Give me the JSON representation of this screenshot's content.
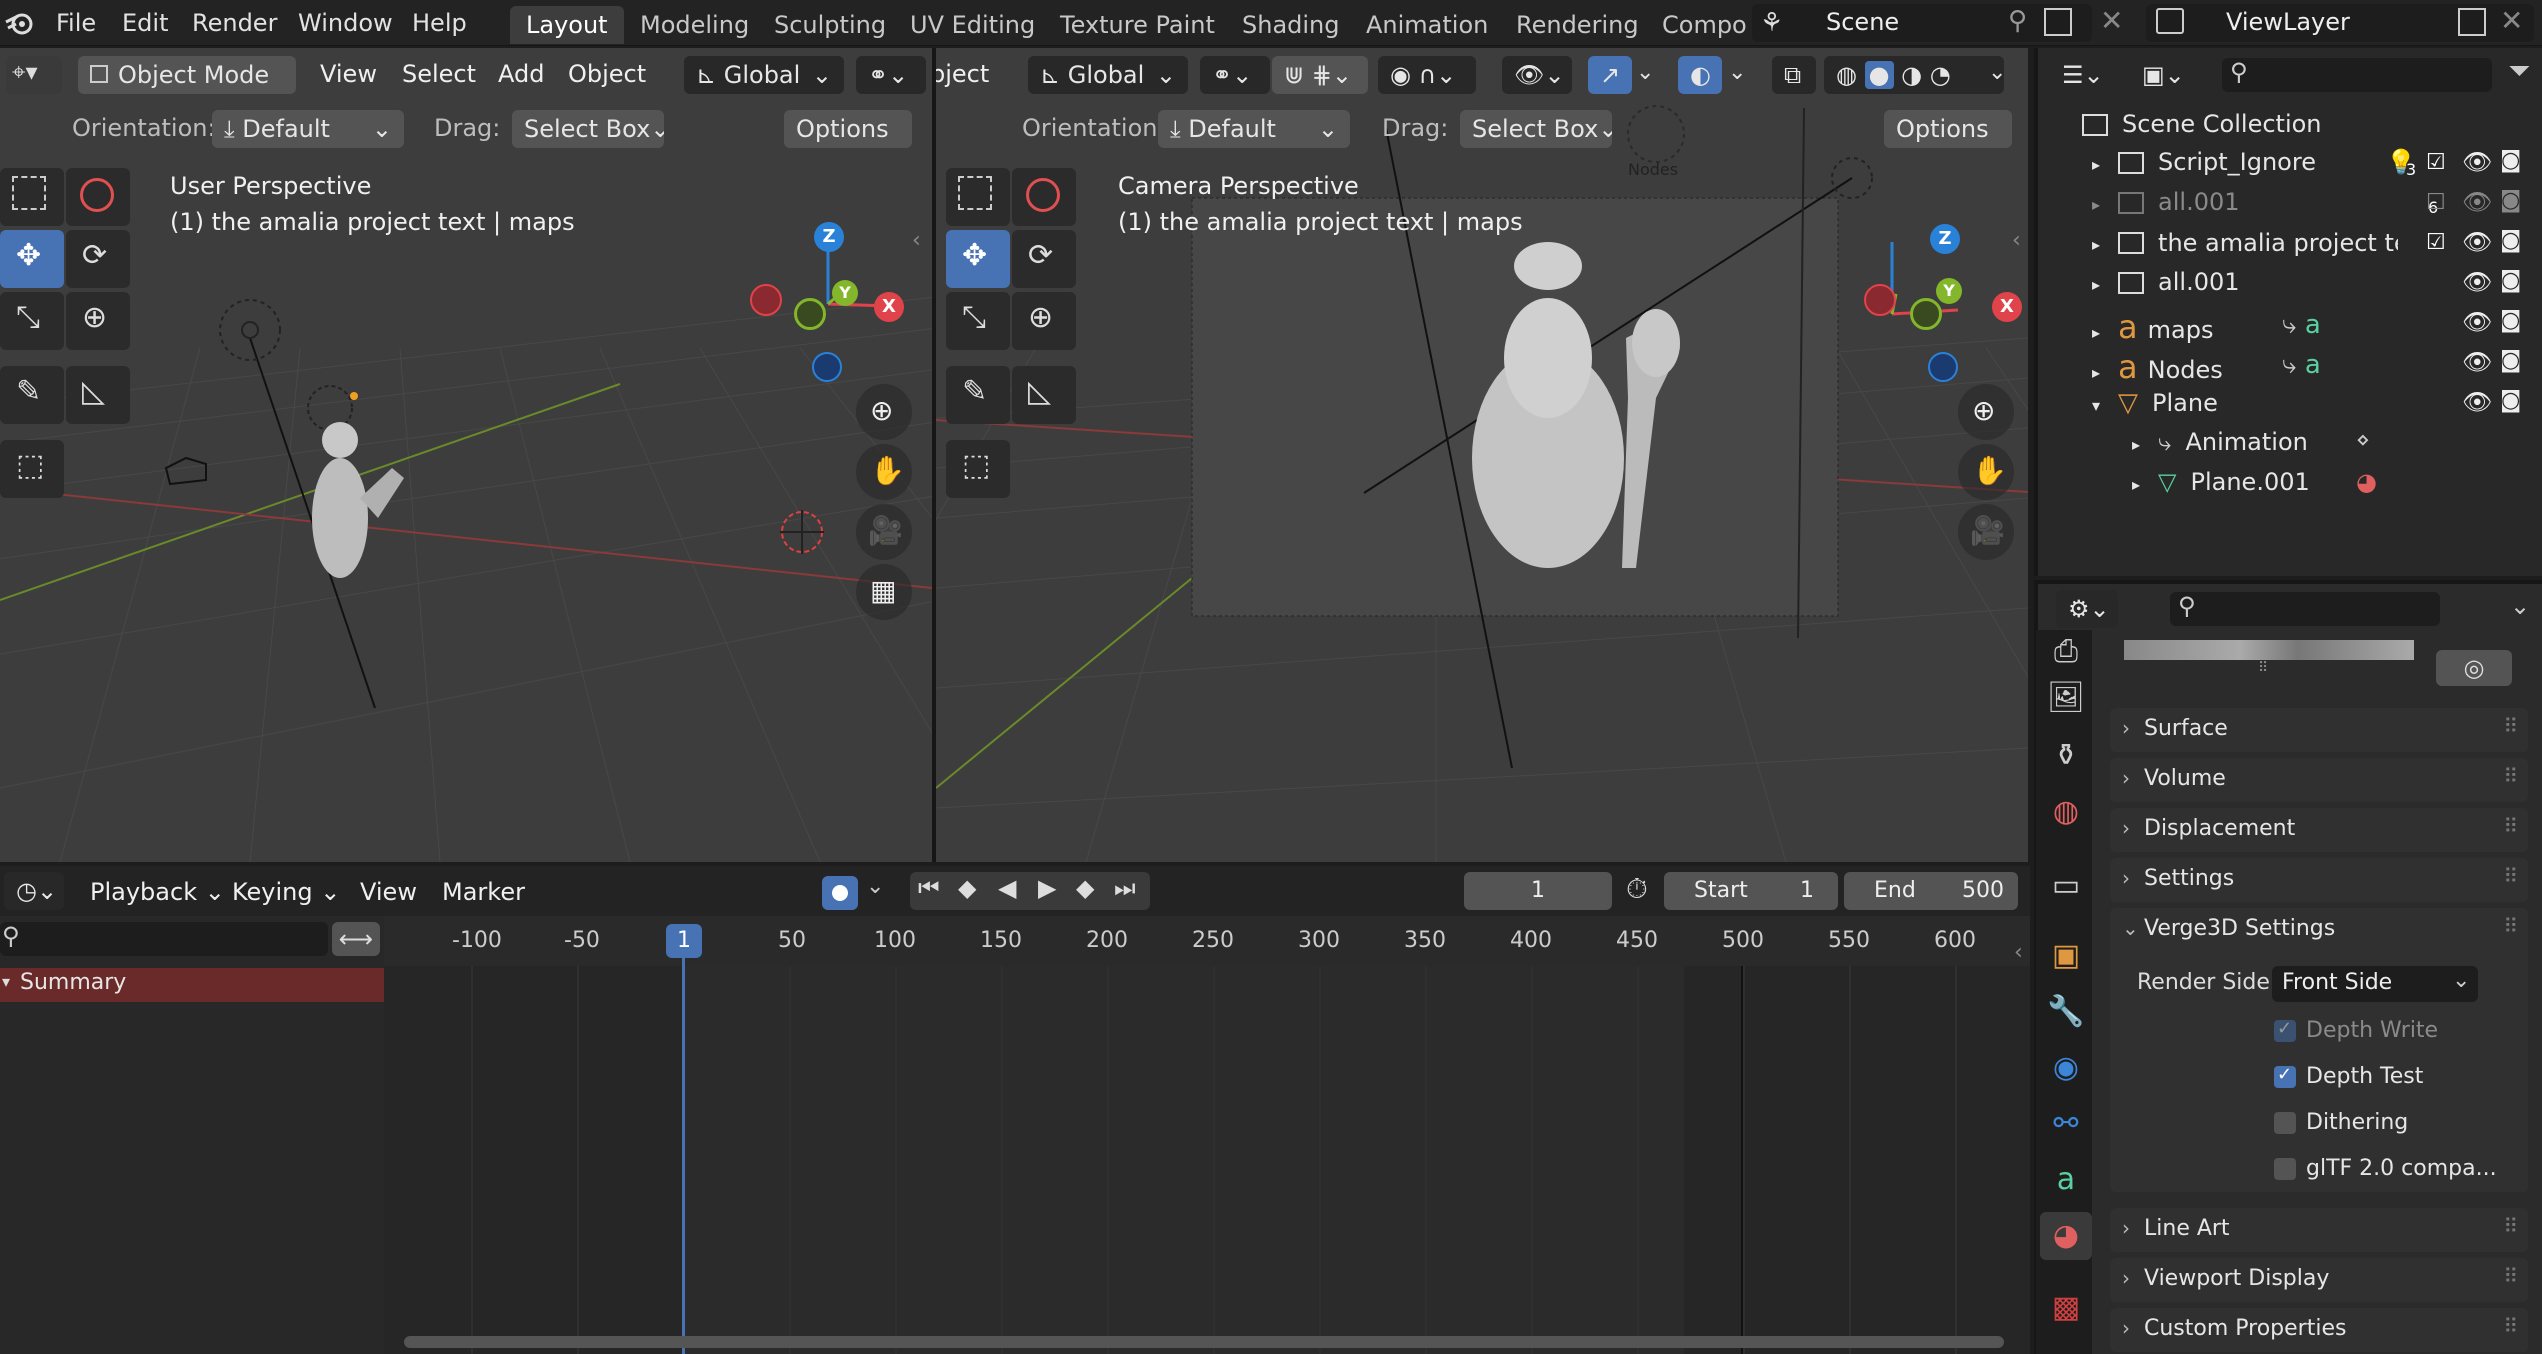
{
  "menu": {
    "file": "File",
    "edit": "Edit",
    "render": "Render",
    "window": "Window",
    "help": "Help"
  },
  "workspaces": [
    "Layout",
    "Modeling",
    "Sculpting",
    "UV Editing",
    "Texture Paint",
    "Shading",
    "Animation",
    "Rendering",
    "Compo"
  ],
  "scene": "Scene",
  "view_layer": "ViewLayer",
  "left_view": {
    "mode": "Object Mode",
    "view": "View",
    "select": "Select",
    "add": "Add",
    "object": "Object",
    "transform": "Global",
    "orientation_label": "Orientation:",
    "orientation": "Default",
    "drag_label": "Drag:",
    "drag": "Select Box",
    "options": "Options",
    "title": "User Perspective",
    "subtitle": "(1) the amalia project text | maps"
  },
  "right_view": {
    "partial": "bject",
    "transform": "Global",
    "orientation_label": "Orientation:",
    "orientation": "Default",
    "drag_label": "Drag:",
    "drag": "Select Box",
    "options": "Options",
    "title": "Camera Perspective",
    "subtitle": "(1) the amalia project text | maps",
    "nodes_label": "Nodes"
  },
  "gizmo": {
    "x": "X",
    "y": "Y",
    "z": "Z"
  },
  "outliner": {
    "root": "Scene Collection",
    "items": [
      {
        "label": "Script_Ignore",
        "badge": "3"
      },
      {
        "label": "all.001",
        "badge": "6"
      },
      {
        "label": "the amalia project text"
      },
      {
        "label": "all.001"
      },
      {
        "label": "maps"
      },
      {
        "label": "Nodes"
      },
      {
        "label": "Plane"
      },
      {
        "label": "Animation"
      },
      {
        "label": "Plane.001"
      }
    ]
  },
  "properties": {
    "sections": [
      "Surface",
      "Volume",
      "Displacement",
      "Settings"
    ],
    "verge": {
      "title": "Verge3D Settings",
      "render_side_label": "Render Side",
      "render_side": "Front Side",
      "checks": [
        {
          "label": "Depth Write",
          "checked": true,
          "disabled": true
        },
        {
          "label": "Depth Test",
          "checked": true
        },
        {
          "label": "Dithering",
          "checked": false
        },
        {
          "label": "glTF 2.0 compa...",
          "checked": false
        }
      ]
    },
    "sections2": [
      "Line Art",
      "Viewport Display",
      "Custom Properties"
    ]
  },
  "timeline": {
    "playback": "Playback",
    "keying": "Keying",
    "view": "View",
    "marker": "Marker",
    "current_frame": "1",
    "start_label": "Start",
    "start": "1",
    "end_label": "End",
    "end": "500",
    "ruler": [
      "-100",
      "-50",
      "1",
      "50",
      "100",
      "150",
      "200",
      "250",
      "300",
      "350",
      "400",
      "450",
      "500",
      "550",
      "600"
    ],
    "summary": "Summary"
  },
  "colors": {
    "accent": "#4772b3",
    "x_axis": "#e0434a",
    "y_axis": "#83b62b",
    "z_axis": "#2a82d8",
    "summary": "#6b2a2a"
  }
}
